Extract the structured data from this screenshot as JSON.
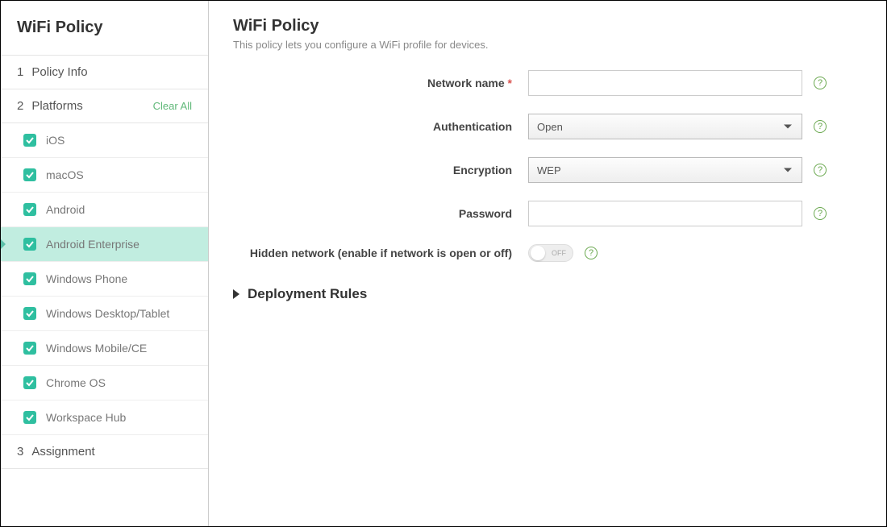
{
  "sidebar": {
    "title": "WiFi Policy",
    "steps": {
      "policy_info": {
        "num": "1",
        "label": "Policy Info"
      },
      "platforms": {
        "num": "2",
        "label": "Platforms",
        "clear_all": "Clear All"
      },
      "assignment": {
        "num": "3",
        "label": "Assignment"
      }
    },
    "platforms": [
      {
        "id": "ios",
        "label": "iOS",
        "active": false
      },
      {
        "id": "macos",
        "label": "macOS",
        "active": false
      },
      {
        "id": "android",
        "label": "Android",
        "active": false
      },
      {
        "id": "android-enterprise",
        "label": "Android Enterprise",
        "active": true
      },
      {
        "id": "windows-phone",
        "label": "Windows Phone",
        "active": false
      },
      {
        "id": "windows-desktop",
        "label": "Windows Desktop/Tablet",
        "active": false
      },
      {
        "id": "windows-mobile",
        "label": "Windows Mobile/CE",
        "active": false
      },
      {
        "id": "chrome-os",
        "label": "Chrome OS",
        "active": false
      },
      {
        "id": "workspace-hub",
        "label": "Workspace Hub",
        "active": false
      }
    ]
  },
  "main": {
    "title": "WiFi Policy",
    "subtitle": "This policy lets you configure a WiFi profile for devices.",
    "fields": {
      "network_name": {
        "label": "Network name",
        "required": "*",
        "value": ""
      },
      "authentication": {
        "label": "Authentication",
        "value": "Open"
      },
      "encryption": {
        "label": "Encryption",
        "value": "WEP"
      },
      "password": {
        "label": "Password",
        "value": ""
      },
      "hidden_network": {
        "label": "Hidden network (enable if network is open or off)",
        "toggle_state": "OFF"
      }
    },
    "deployment_rules": "Deployment Rules"
  }
}
